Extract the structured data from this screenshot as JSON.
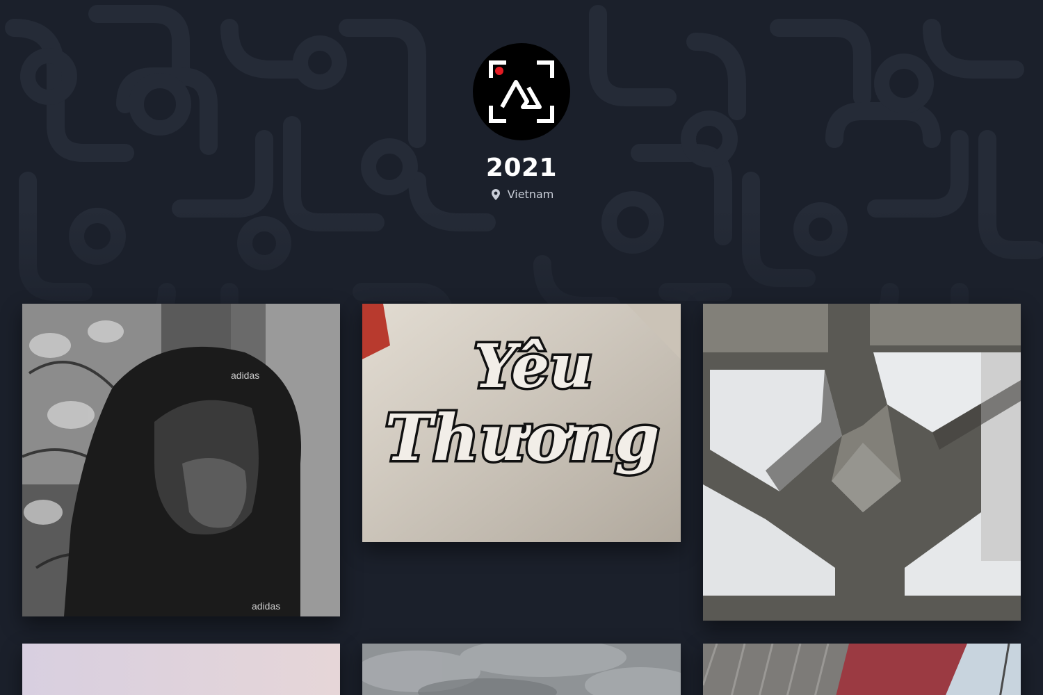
{
  "profile": {
    "title": "2021",
    "location": "Vietnam",
    "location_icon": "map-pin-icon",
    "avatar_icon": "camera-frame-logo"
  },
  "photos": [
    {
      "subject": "hooded-person"
    },
    {
      "subject": "lettering-sign",
      "lettering": [
        "Yêu",
        "Thương"
      ]
    },
    {
      "subject": "concrete-lattice"
    },
    {
      "subject": "pale-sky"
    },
    {
      "subject": "cloudy-sky"
    },
    {
      "subject": "red-roof"
    }
  ],
  "colors": {
    "background": "#1b202b",
    "pattern": "#262c38",
    "title": "#ffffff",
    "location_text": "#c9ced8",
    "logo_accent": "#e31b23"
  }
}
